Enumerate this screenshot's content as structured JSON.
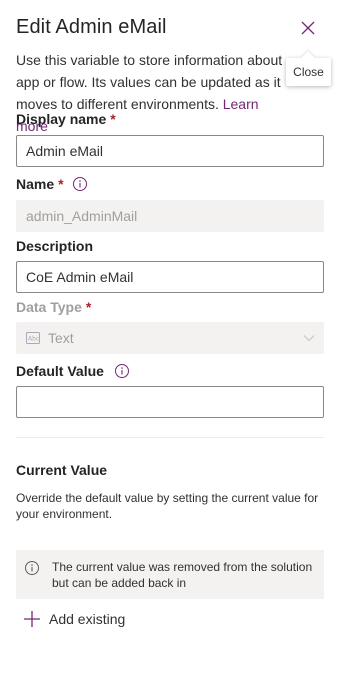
{
  "panel": {
    "title": "Edit Admin eMail",
    "close_tooltip": "Close",
    "description": "Use this variable to store information about app or flow. Its values can be updated as it moves to different environments.",
    "learn_more": "Learn more"
  },
  "fields": {
    "display_name": {
      "label": "Display name",
      "required": "*",
      "value": "Admin eMail"
    },
    "name": {
      "label": "Name",
      "required": "*",
      "value": "admin_AdminMail"
    },
    "description": {
      "label": "Description",
      "value": "CoE Admin eMail"
    },
    "data_type": {
      "label": "Data Type",
      "required": "*",
      "value": "Text"
    },
    "default_value": {
      "label": "Default Value",
      "value": ""
    }
  },
  "current_value": {
    "title": "Current Value",
    "description": "Override the default value by setting the current value for your environment.",
    "message": "The current value was removed from the solution but can be added back in",
    "add_existing": "Add existing"
  },
  "icons": {
    "close": "close-icon",
    "info": "info-icon",
    "text_type": "text-type-icon",
    "chevron": "chevron-down-icon",
    "plus": "plus-icon"
  },
  "colors": {
    "accent": "#742774",
    "required": "#a4262c",
    "disabled_text": "#a19f9d",
    "message_bg": "#f3f2f1"
  }
}
